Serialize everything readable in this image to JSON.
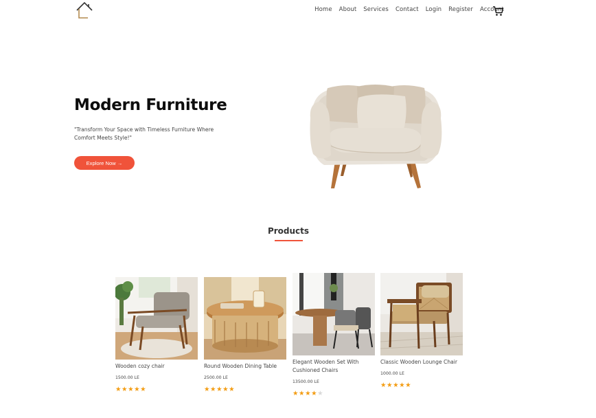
{
  "nav": {
    "items": [
      "Home",
      "About",
      "Services",
      "Contact",
      "Login",
      "Register",
      "Account"
    ],
    "cart_icon": "cart-icon",
    "logo_icon": "house-icon"
  },
  "hero": {
    "title": "Modern Furniture",
    "subtitle": "\"Transform Your Space with Timeless Furniture Where Comfort Meets Style!\"",
    "button_label": "Explore Now →",
    "accent_color": "#f0533a"
  },
  "products": {
    "title": "Products",
    "items": [
      {
        "name": "Wooden cozy chair",
        "price": "1500.00 LE",
        "rating": 5
      },
      {
        "name": "Round Wooden Dining Table",
        "price": "2500.00 LE",
        "rating": 5
      },
      {
        "name": "Elegant Wooden Set With Cushioned Chairs",
        "price": "13500.00 LE",
        "rating": 4
      },
      {
        "name": "Classic Wooden Lounge Chair",
        "price": "1000.00 LE",
        "rating": 5
      }
    ]
  }
}
